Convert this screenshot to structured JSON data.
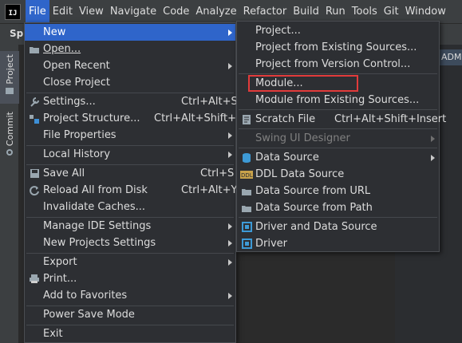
{
  "menubar": {
    "logo_text": "IJ",
    "items": [
      "File",
      "Edit",
      "View",
      "Navigate",
      "Code",
      "Analyze",
      "Refactor",
      "Build",
      "Run",
      "Tools",
      "Git",
      "Window"
    ]
  },
  "toolbar": {
    "project_short": "Spr"
  },
  "left_stripe": {
    "tabs": [
      "Project",
      "Commit"
    ]
  },
  "right_panel": {
    "tab_label": "ADME"
  },
  "file_menu": {
    "items": [
      {
        "label": "New",
        "icon": "none",
        "arrow": true,
        "selected": true
      },
      {
        "label": "Open...",
        "icon": "folder-icon"
      },
      {
        "label": "Open Recent",
        "arrow": true
      },
      {
        "label": "Close Project"
      },
      {
        "label": "Settings...",
        "icon": "wrench-icon",
        "shortcut": "Ctrl+Alt+S"
      },
      {
        "label": "Project Structure...",
        "icon": "project-structure-icon",
        "shortcut": "Ctrl+Alt+Shift+S"
      },
      {
        "label": "File Properties",
        "arrow": true
      },
      {
        "label": "Local History",
        "arrow": true
      },
      {
        "label": "Save All",
        "icon": "save-icon",
        "shortcut": "Ctrl+S"
      },
      {
        "label": "Reload All from Disk",
        "icon": "reload-icon",
        "shortcut": "Ctrl+Alt+Y"
      },
      {
        "label": "Invalidate Caches..."
      },
      {
        "label": "Manage IDE Settings",
        "arrow": true
      },
      {
        "label": "New Projects Settings",
        "arrow": true
      },
      {
        "label": "Export",
        "arrow": true
      },
      {
        "label": "Print...",
        "icon": "print-icon"
      },
      {
        "label": "Add to Favorites",
        "arrow": true
      },
      {
        "label": "Power Save Mode"
      },
      {
        "label": "Exit"
      }
    ]
  },
  "new_submenu": {
    "items": [
      {
        "label": "Project..."
      },
      {
        "label": "Project from Existing Sources..."
      },
      {
        "label": "Project from Version Control..."
      },
      {
        "label": "Module...",
        "highlighted": true
      },
      {
        "label": "Module from Existing Sources..."
      },
      {
        "label": "Scratch File",
        "icon": "scratch-file-icon",
        "shortcut": "Ctrl+Alt+Shift+Insert"
      },
      {
        "label": "Swing UI Designer",
        "disabled": true,
        "arrow": true
      },
      {
        "label": "Data Source",
        "icon": "database-icon",
        "arrow": true
      },
      {
        "label": "DDL Data Source",
        "icon": "ddl-icon"
      },
      {
        "label": "Data Source from URL",
        "icon": "folder-icon"
      },
      {
        "label": "Data Source from Path",
        "icon": "folder-icon"
      },
      {
        "label": "Driver and Data Source",
        "icon": "driver-icon"
      },
      {
        "label": "Driver",
        "icon": "driver-icon"
      }
    ]
  },
  "colors": {
    "selection": "#2f65ca",
    "menu_bg": "#2d2f33",
    "highlight_box": "#e23b3b"
  }
}
